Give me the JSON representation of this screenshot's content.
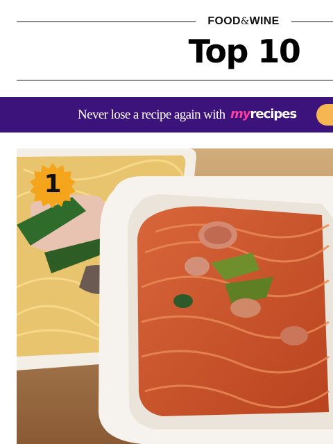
{
  "header": {
    "brand_left": "FOOD",
    "brand_amp": "&",
    "brand_right": "WINE",
    "title": "Top 10"
  },
  "promo": {
    "text": "Never lose a recipe again with",
    "logo_my": "my",
    "logo_rest": "recipes"
  },
  "item": {
    "rank": "1"
  },
  "colors": {
    "promo_background": "#3c137a",
    "promo_logo_accent": "#ff3da0",
    "promo_button": "#f6b752",
    "rank_badge": "#f4a51c"
  },
  "icons": {
    "rank_badge": "star-burst-badge"
  }
}
